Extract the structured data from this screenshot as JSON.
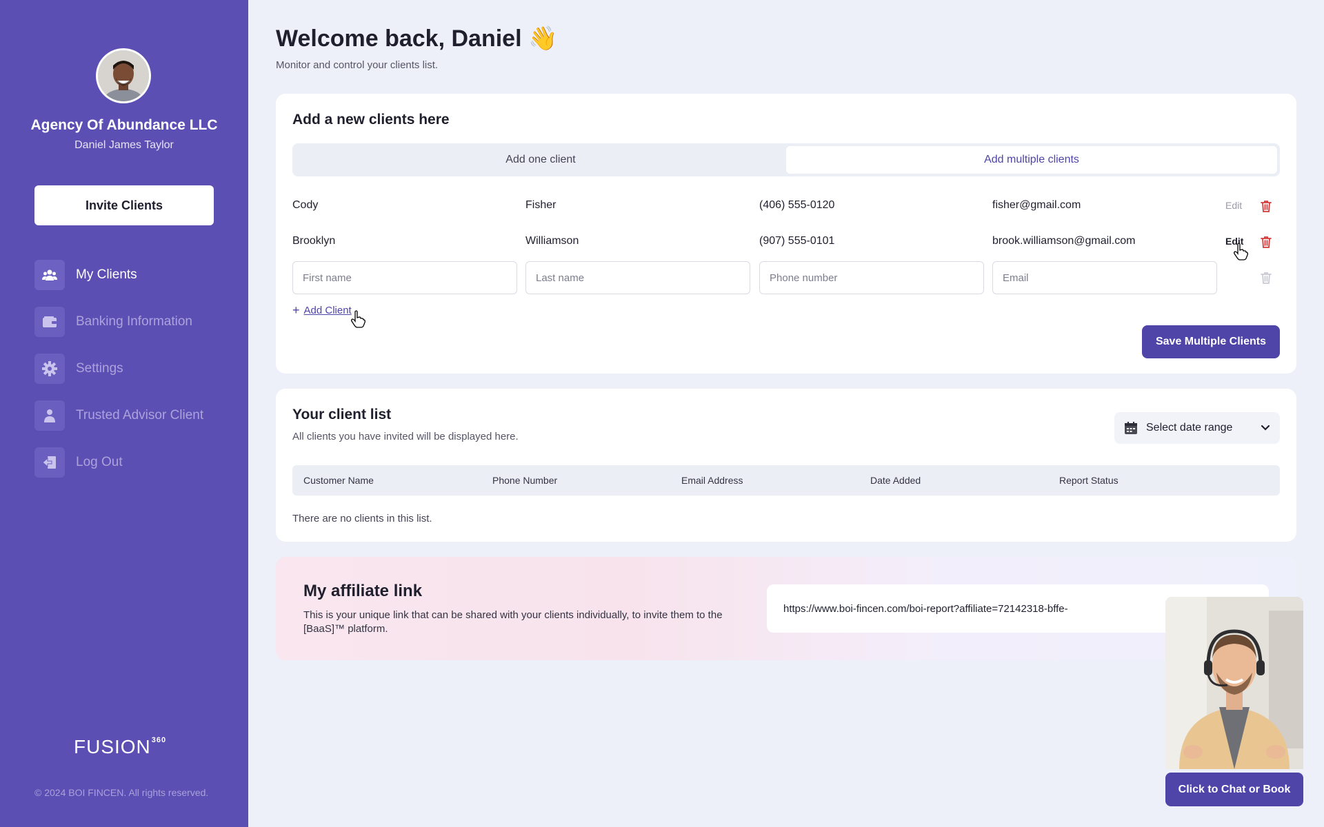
{
  "sidebar": {
    "agency_name": "Agency Of Abundance LLC",
    "user_name": "Daniel James Taylor",
    "invite_label": "Invite Clients",
    "items": [
      {
        "label": "My Clients",
        "icon": "users-icon",
        "active": true
      },
      {
        "label": "Banking Information",
        "icon": "wallet-icon",
        "active": false
      },
      {
        "label": "Settings",
        "icon": "gear-icon",
        "active": false
      },
      {
        "label": "Trusted Advisor Client",
        "icon": "person-icon",
        "active": false
      },
      {
        "label": "Log Out",
        "icon": "logout-icon",
        "active": false
      }
    ],
    "brand_name": "FUSION",
    "brand_sup": "360",
    "copyright": "© 2024 BOI FINCEN. All rights reserved."
  },
  "header": {
    "title": "Welcome back, Daniel 👋",
    "subtitle": "Monitor and control your clients list."
  },
  "add_clients": {
    "title": "Add a new clients here",
    "tabs": [
      {
        "label": "Add one client",
        "active": false
      },
      {
        "label": "Add multiple clients",
        "active": true
      }
    ],
    "rows": [
      {
        "first": "Cody",
        "last": "Fisher",
        "phone": "(406) 555-0120",
        "email": "fisher@gmail.com",
        "edit": "Edit"
      },
      {
        "first": "Brooklyn",
        "last": "Williamson",
        "phone": "(907) 555-0101",
        "email": "brook.williamson@gmail.com",
        "edit": "Edit"
      }
    ],
    "placeholders": {
      "first": "First name",
      "last": "Last name",
      "phone": "Phone number",
      "email": "Email"
    },
    "add_client_label": "Add Client",
    "save_label": "Save Multiple Clients"
  },
  "client_list": {
    "title": "Your client list",
    "subtitle": "All clients you have invited will be displayed here.",
    "date_range_label": "Select date range",
    "columns": [
      "Customer Name",
      "Phone Number",
      "Email Address",
      "Date Added",
      "Report Status"
    ],
    "empty_text": "There are no clients in this list."
  },
  "affiliate": {
    "title": "My affiliate link",
    "description": "This is your unique link that can be shared with your clients individually, to invite them to the [BaaS]™ platform.",
    "link": "https://www.boi-fincen.com/boi-report?affiliate=72142318-bffe-"
  },
  "chat": {
    "button_label": "Click to Chat or Book"
  },
  "colors": {
    "sidebar_bg": "#5b4fb3",
    "accent": "#4f44a8",
    "page_bg": "#eef0f9",
    "danger": "#d33a3a"
  }
}
